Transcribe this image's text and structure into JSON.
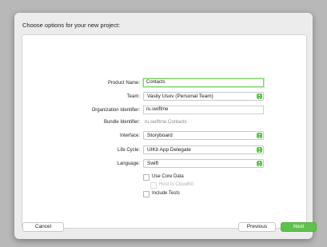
{
  "dialog": {
    "title": "Choose options for your new project:"
  },
  "form": {
    "product_name_label": "Product Name:",
    "product_name_value": "Contacts",
    "team_label": "Team:",
    "team_value": "Vasily Usov (Personal Team)",
    "org_id_label": "Organization Identifier:",
    "org_id_value": "ru.swiftme",
    "bundle_id_label": "Bundle Identifier:",
    "bundle_id_value": "ru.swiftme.Contacts",
    "interface_label": "Interface:",
    "interface_value": "Storyboard",
    "lifecycle_label": "Life Cycle:",
    "lifecycle_value": "UIKit App Delegate",
    "language_label": "Language:",
    "language_value": "Swift",
    "use_core_data": "Use Core Data",
    "host_in_cloudkit": "Host in CloudKit",
    "include_tests": "Include Tests"
  },
  "footer": {
    "cancel": "Cancel",
    "previous": "Previous",
    "next": "Next"
  },
  "icons": {
    "popup_stepper": "up-down-chevron-icon"
  },
  "colors": {
    "accent": "#5fc24e",
    "focus_ring": "#7ed36c"
  }
}
